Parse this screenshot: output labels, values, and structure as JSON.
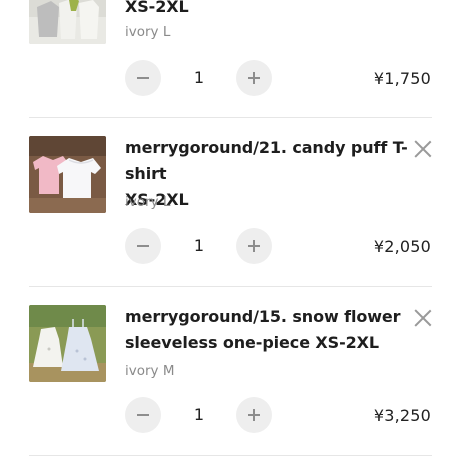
{
  "cart": {
    "items": [
      {
        "title_line2": "XS-2XL",
        "variant": "ivory L",
        "quantity": "1",
        "price": "¥1,750"
      },
      {
        "title_line1": "merrygoround/21. candy puff T-shirt",
        "title_line2": "XS-2XL",
        "variant": "ivory L",
        "quantity": "1",
        "price": "¥2,050"
      },
      {
        "title_line1": "merrygoround/15. snow flower",
        "title_line2": "sleeveless one-piece XS-2XL",
        "variant": "ivory M",
        "quantity": "1",
        "price": "¥3,250"
      }
    ]
  }
}
